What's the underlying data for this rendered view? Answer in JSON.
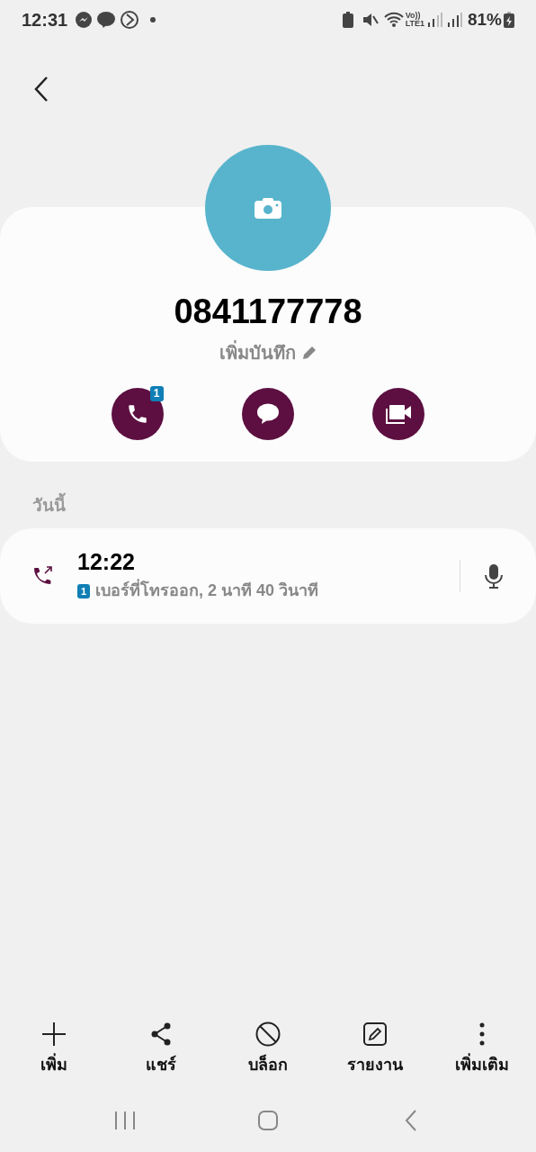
{
  "status_bar": {
    "time": "12:31",
    "network": "Vo))",
    "network_sub": "LTE1",
    "battery": "81%"
  },
  "contact": {
    "name": "0841177778",
    "note": "เพิ่มบันทึก",
    "call_badge": "1"
  },
  "history": {
    "heading": "วันนี้",
    "calls": [
      {
        "time": "12:22",
        "sim": "1",
        "detail": "เบอร์ที่โทรออก, 2 นาที 40 วินาที"
      }
    ]
  },
  "actions": [
    {
      "kind": "add",
      "label": "เพิ่ม"
    },
    {
      "kind": "share",
      "label": "แชร์"
    },
    {
      "kind": "block",
      "label": "บล็อก"
    },
    {
      "kind": "report",
      "label": "รายงาน"
    },
    {
      "kind": "more",
      "label": "เพิ่มเติม"
    }
  ]
}
